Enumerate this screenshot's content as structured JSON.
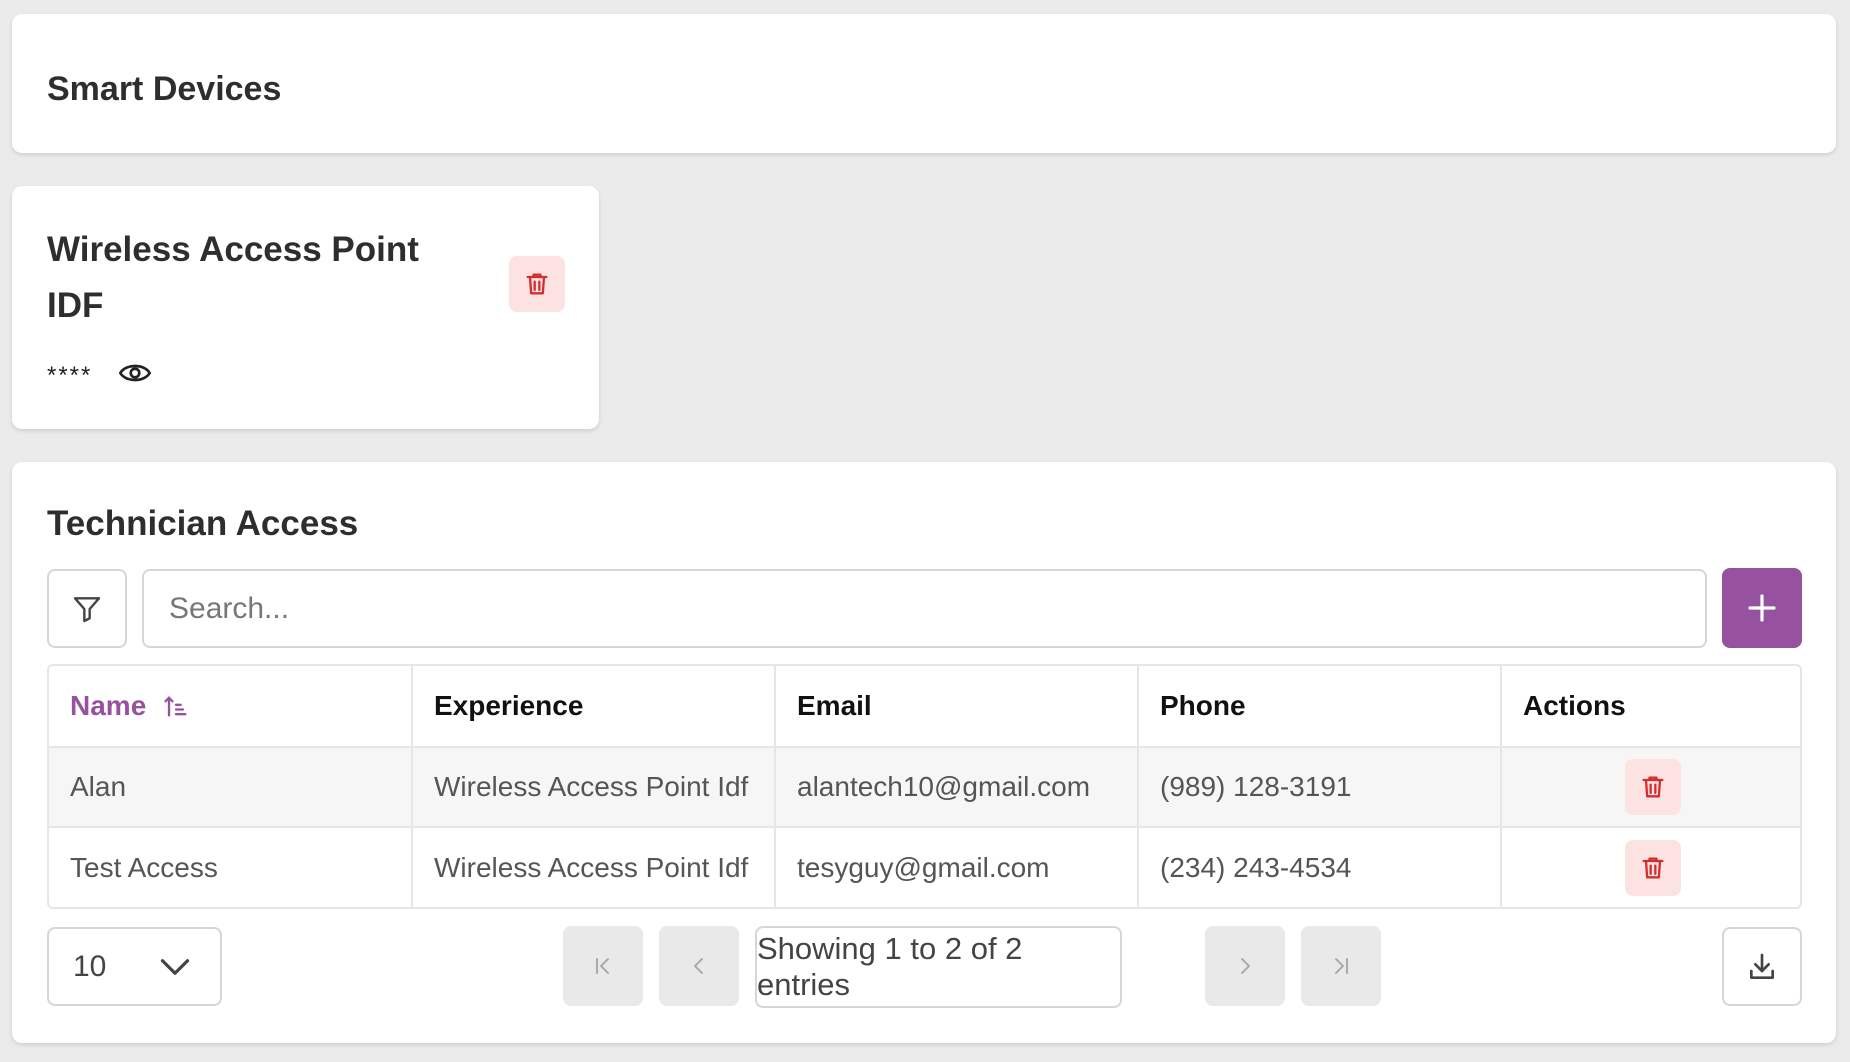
{
  "header": {
    "title": "Smart Devices"
  },
  "device": {
    "title": "Wireless Access Point IDF",
    "masked_value": "****",
    "icons": {
      "reveal": "eye-icon",
      "delete": "trash-icon"
    }
  },
  "technician": {
    "title": "Technician Access",
    "search": {
      "placeholder": "Search...",
      "value": ""
    },
    "icons": {
      "filter": "filter-icon",
      "add": "plus-icon",
      "sort": "sort-ascending-icon"
    },
    "table": {
      "columns": [
        "Name",
        "Experience",
        "Email",
        "Phone",
        "Actions"
      ],
      "sorted_column": "Name",
      "rows": [
        {
          "name": "Alan",
          "experience": "Wireless Access Point Idf",
          "email": "alantech10@gmail.com",
          "phone": "(989) 128-3191"
        },
        {
          "name": "Test Access",
          "experience": "Wireless Access Point Idf",
          "email": "tesyguy@gmail.com",
          "phone": "(234) 243-4534"
        }
      ]
    },
    "pagination": {
      "page_size": "10",
      "info": "Showing 1 to 2 of 2 entries"
    }
  },
  "colors": {
    "accent": "#96529f",
    "danger": "#d32f2f",
    "danger_bg": "#fde2e2",
    "page_bg": "#ebebeb"
  }
}
